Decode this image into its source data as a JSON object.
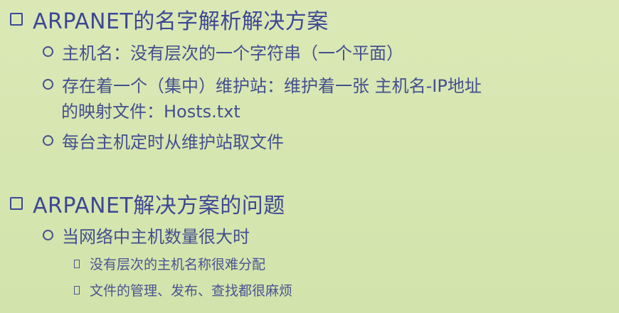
{
  "section1": {
    "heading": "ARPANET的名字解析解决方案",
    "items": [
      "主机名：没有层次的一个字符串（一个平面）",
      "存在着一个（集中）维护站：维护着一张 主机名-IP地址",
      "每台主机定时从维护站取文件"
    ],
    "item2_continuation": "的映射文件：Hosts.txt"
  },
  "section2": {
    "heading": "ARPANET解决方案的问题",
    "items": [
      "当网络中主机数量很大时"
    ],
    "subitems": [
      "没有层次的主机名称很难分配",
      "文件的管理、发布、查找都很麻烦"
    ]
  }
}
